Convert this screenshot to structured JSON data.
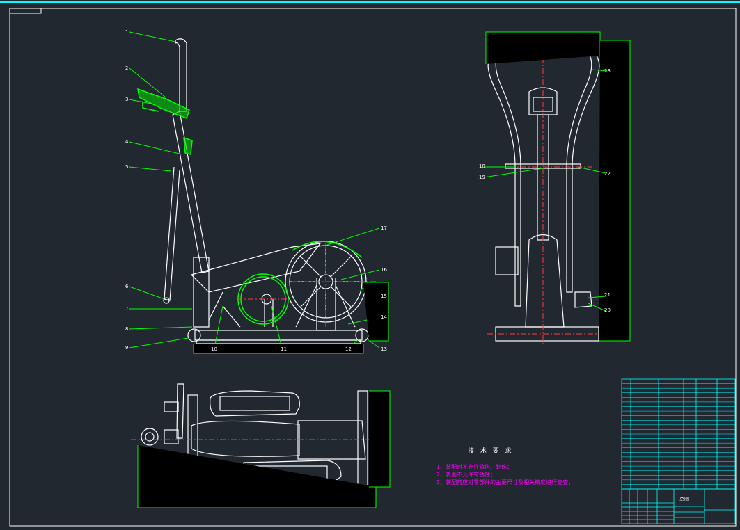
{
  "drawing": {
    "balloons_side": [
      "1",
      "2",
      "3",
      "4",
      "5",
      "6",
      "7",
      "8",
      "9",
      "10",
      "11",
      "17",
      "16",
      "15",
      "14",
      "12",
      "13"
    ],
    "balloons_front": [
      "23",
      "18",
      "19",
      "22",
      "21",
      "20"
    ],
    "tech_requirements": {
      "title": "技 术 要 求",
      "items": [
        "1、装配时不允许磕伤、划伤；",
        "2、表面不允许有锈蚀；",
        "3、装配前应对零部件的主要尺寸及相关精度进行复查；"
      ]
    },
    "title_block": {
      "drawing_name": "总图"
    },
    "colors": {
      "background": "#212830",
      "line": "#ffffff",
      "highlight": "#00ff00",
      "center": "#ff3b3b",
      "dimension": "#00ff00",
      "frame": "#00ffff",
      "note": "#ff00ff"
    }
  }
}
